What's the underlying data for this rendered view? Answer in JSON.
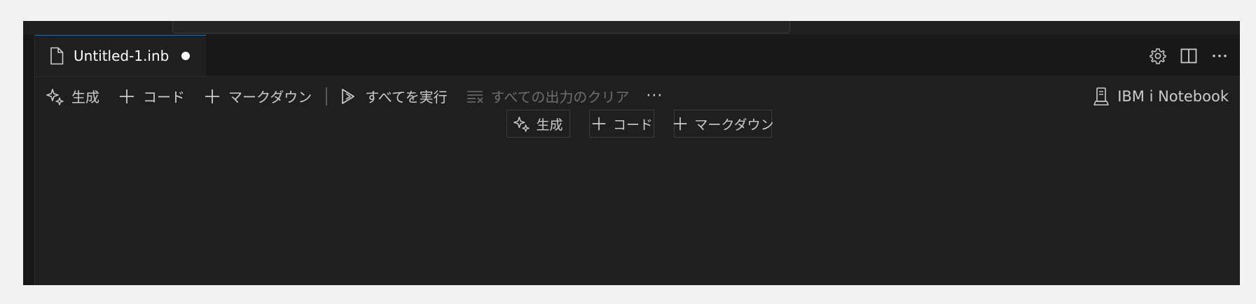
{
  "tab": {
    "title": "Untitled-1.inb",
    "file_icon": "file-icon",
    "dirty": true
  },
  "tab_actions": [
    {
      "name": "settings",
      "icon": "gear-icon"
    },
    {
      "name": "split-editor",
      "icon": "split-editor-icon"
    },
    {
      "name": "more-actions",
      "icon": "ellipsis-icon"
    }
  ],
  "toolbar": {
    "generate_label": "生成",
    "code_label": "コード",
    "markdown_label": "マークダウン",
    "run_all_label": "すべてを実行",
    "clear_outputs_label": "すべての出力のクリア",
    "more_label": "···"
  },
  "kernel": {
    "label": "IBM i Notebook",
    "icon": "server-icon"
  },
  "insert": {
    "generate_label": "生成",
    "code_label": "コード",
    "markdown_label": "マークダウン"
  },
  "colors": {
    "background": "#1f1f1f",
    "tab_bar": "#181818",
    "accent": "#0078d4",
    "text": "#cccccc",
    "disabled_text": "#6d6d6d"
  }
}
